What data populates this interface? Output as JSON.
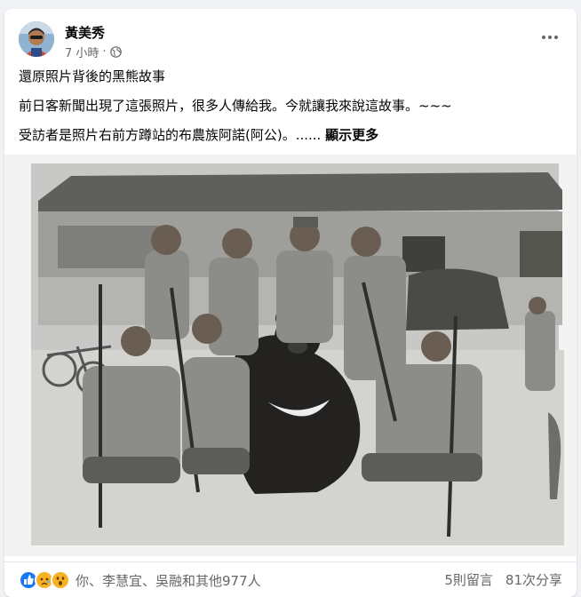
{
  "post": {
    "author": "黃美秀",
    "time": "7 小時",
    "separator": "·",
    "privacy_icon": "globe-icon",
    "menu_icon": "more-horizontal-icon",
    "lines": [
      "還原照片背後的黑熊故事",
      "前日客新聞出現了這張照片，很多人傳給我。今就讓我來說這故事。~~~",
      "受訪者是照片右前方蹲站的布農族阿諾(阿公)。......"
    ],
    "see_more": "顯示更多"
  },
  "reactions": {
    "icons": [
      "like-icon",
      "sad-icon",
      "wow-icon"
    ],
    "text": "你、李慧宜、吳融和其他977人"
  },
  "stats": {
    "comments": "5則留言",
    "shares": "81次分享"
  },
  "colors": {
    "like": "#1877f2",
    "emoji": "#f7b125",
    "secondary_text": "#65676b"
  }
}
